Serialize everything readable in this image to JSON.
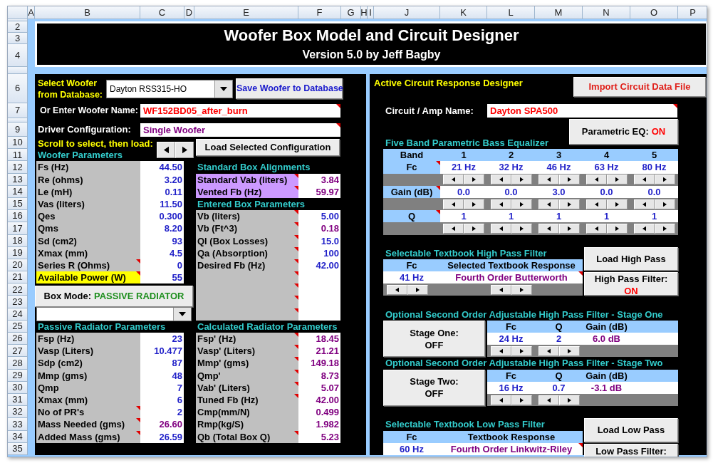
{
  "column_headers": [
    "A",
    "B",
    "C",
    "D",
    "E",
    "F",
    "G",
    "H",
    "I",
    "J",
    "K",
    "L",
    "M",
    "N",
    "O",
    "P"
  ],
  "row_headers": [
    "2",
    "3",
    "4",
    "6",
    "7",
    "9",
    "10",
    "11",
    "12",
    "13",
    "14",
    "15",
    "16",
    "17",
    "18",
    "19",
    "20",
    "21",
    "22",
    "23",
    "24",
    "25",
    "26",
    "27",
    "28",
    "29",
    "30",
    "31",
    "32",
    "33",
    "34",
    "35"
  ],
  "title": "Woofer Box Model and Circuit Designer",
  "subtitle": "Version 5.0 by Jeff Bagby",
  "woofer_select": {
    "label": "Select Woofer from Database:",
    "value": "Dayton RSS315-HO"
  },
  "save_button": "Save Woofer to Database",
  "woofer_name": {
    "label": "Or Enter Woofer Name:",
    "value": "WF152BD05_after_burn",
    "comment": true
  },
  "driver_configuration": {
    "label": "Driver Configuration:",
    "value": "Single Woofer",
    "comment": true
  },
  "scroll_label": "Scroll to select, then load:",
  "load_configuration_button": "Load Selected Configuration",
  "woofer_parameters": {
    "title": "Woofer Parameters",
    "rows": [
      {
        "label": "Fs (Hz)",
        "value": "44.50",
        "kind": "input",
        "comment": false,
        "highlight": false
      },
      {
        "label": "Re (ohms)",
        "value": "3.20",
        "kind": "input",
        "comment": false,
        "highlight": false
      },
      {
        "label": "Le (mH)",
        "value": "0.11",
        "kind": "input",
        "comment": false,
        "highlight": false
      },
      {
        "label": "Vas (liters)",
        "value": "11.50",
        "kind": "input",
        "comment": false,
        "highlight": false
      },
      {
        "label": "Qes",
        "value": "0.300",
        "kind": "input",
        "comment": false,
        "highlight": false
      },
      {
        "label": "Qms",
        "value": "8.20",
        "kind": "input",
        "comment": false,
        "highlight": false
      },
      {
        "label": "Sd (cm2)",
        "value": "93",
        "kind": "input",
        "comment": false,
        "highlight": false
      },
      {
        "label": "Xmax (mm)",
        "value": "4.5",
        "kind": "input",
        "comment": false,
        "highlight": false
      },
      {
        "label": "Series R (Ohms)",
        "value": "0",
        "kind": "input",
        "comment": true,
        "highlight": false
      },
      {
        "label": "Available Power (W)",
        "value": "55",
        "kind": "input",
        "comment": true,
        "highlight": true
      }
    ]
  },
  "standard_box_alignments": {
    "title": "Standard Box Alignments",
    "rows": [
      {
        "label": "Standard Vab (liters)",
        "value": "3.84",
        "kind": "calculated",
        "comment": true
      },
      {
        "label": "Vented Fb (Hz)",
        "value": "59.97",
        "kind": "calculated",
        "comment": true
      }
    ]
  },
  "entered_box_parameters": {
    "title": "Entered Box Parameters",
    "rows": [
      {
        "label": "Vb (liters)",
        "value": "5.00",
        "kind": "input",
        "comment": true
      },
      {
        "label": "Vb (Ft^3)",
        "value": "0.18",
        "kind": "calculated",
        "comment": true
      },
      {
        "label": "Ql (Box Losses)",
        "value": "15.0",
        "kind": "input",
        "comment": true
      },
      {
        "label": "Qa (Absorption)",
        "value": "100",
        "kind": "input",
        "comment": true
      },
      {
        "label": "Desired Fb (Hz)",
        "value": "42.00",
        "kind": "input",
        "comment": true
      },
      {
        "comment": true
      },
      {
        "comment": true
      },
      {
        "comment": true
      },
      {
        "comment": true
      }
    ]
  },
  "box_mode": {
    "label": "Box Mode:",
    "value": "PASSIVE RADIATOR"
  },
  "passive_radiator_parameters": {
    "title": "Passive Radiator Parameters",
    "rows": [
      {
        "label": "Fsp (Hz)",
        "value": "23",
        "kind": "input",
        "comment": false
      },
      {
        "label": "Vasp (Liters)",
        "value": "10.477",
        "kind": "input",
        "comment": false
      },
      {
        "label": "Sdp (cm2)",
        "value": "87",
        "kind": "input",
        "comment": false
      },
      {
        "label": "Mmp (gms)",
        "value": "48",
        "kind": "input",
        "comment": false
      },
      {
        "label": "Qmp",
        "value": "7",
        "kind": "input",
        "comment": false
      },
      {
        "label": "Xmax (mm)",
        "value": "6",
        "kind": "input",
        "comment": false
      },
      {
        "label": "No of PR's",
        "value": "2",
        "kind": "input",
        "comment": true
      },
      {
        "label": "Mass Needed (gms)",
        "value": "26.60",
        "kind": "calculated",
        "comment": true
      },
      {
        "label": "Added Mass (gms)",
        "value": "26.59",
        "kind": "input",
        "comment": true
      }
    ]
  },
  "calculated_radiator_parameters": {
    "title": "Calculated Radiator Parameters",
    "rows": [
      {
        "label": "Fsp' (Hz)",
        "value": "18.45",
        "kind": "calculated",
        "comment": true
      },
      {
        "label": "Vasp' (Liters)",
        "value": "21.21",
        "kind": "calculated",
        "comment": true
      },
      {
        "label": "Mmp' (gms)",
        "value": "149.18",
        "kind": "calculated",
        "comment": true
      },
      {
        "label": "Qmp'",
        "value": "8.73",
        "kind": "calculated",
        "comment": true
      },
      {
        "label": "Vab' (Liters)",
        "value": "5.07",
        "kind": "calculated",
        "comment": true
      },
      {
        "label": "Tuned Fb (Hz)",
        "value": "42.00",
        "kind": "calculated",
        "comment": true
      },
      {
        "label": "Cmp(mm/N)",
        "value": "0.499",
        "kind": "calculated",
        "comment": false
      },
      {
        "label": "Rmp(kg/S)",
        "value": "1.982",
        "kind": "calculated",
        "comment": false
      },
      {
        "label": "Qb (Total Box Q)",
        "value": "5.23",
        "kind": "calculated",
        "comment": true
      }
    ]
  },
  "circuit_designer": {
    "title": "Active Circuit Response Designer",
    "import_button": "Import Circuit Data File",
    "name_label": "Circuit / Amp Name:",
    "name_value": "Dayton SPA500",
    "name_comment": true
  },
  "parametric_eq": {
    "toggle": {
      "label": "Parametric EQ:",
      "state": "ON",
      "on": true
    },
    "title": "Five Band Parametric Bass Equalizer",
    "header": "Band",
    "bands": [
      "1",
      "2",
      "3",
      "4",
      "5"
    ],
    "rows": [
      {
        "label": "Fc",
        "comment": true,
        "values": [
          "21 Hz",
          "32 Hz",
          "46 Hz",
          "63 Hz",
          "80 Hz"
        ]
      },
      {
        "label": "Gain (dB)",
        "comment": true,
        "values": [
          "0.0",
          "0.0",
          "3.0",
          "0.0",
          "0.0"
        ]
      },
      {
        "label": "Q",
        "comment": true,
        "values": [
          "1",
          "1",
          "1",
          "1",
          "1"
        ]
      }
    ]
  },
  "high_pass": {
    "title": "Selectable Textbook High Pass Filter",
    "columns": [
      "Fc",
      "Selected Textbook Response"
    ],
    "values": [
      {
        "text": "41 Hz",
        "kind": "input"
      },
      {
        "text": "Fourth Order Butterworth",
        "kind": "calculated"
      }
    ],
    "comment": true,
    "load_button": "Load High Pass",
    "toggle": {
      "label": "High Pass Filter:",
      "state": "ON",
      "on": true
    }
  },
  "stage_one": {
    "title": "Optional Second Order Adjustable High Pass Filter - Stage One",
    "toggle": {
      "label": "Stage One:",
      "state": "OFF",
      "on": false
    },
    "columns": [
      "Fc",
      "Q",
      "Gain (dB)"
    ],
    "values": [
      {
        "text": "24 Hz",
        "kind": "input"
      },
      {
        "text": "2",
        "kind": "input"
      },
      {
        "text": "6.0 dB",
        "kind": "calculated"
      }
    ]
  },
  "stage_two": {
    "title": "Optional Second Order Adjustable High Pass Filter - Stage Two",
    "toggle": {
      "label": "Stage Two:",
      "state": "OFF",
      "on": false
    },
    "columns": [
      "Fc",
      "Q",
      "Gain (dB)"
    ],
    "values": [
      {
        "text": "16 Hz",
        "kind": "input"
      },
      {
        "text": "0.7",
        "kind": "input"
      },
      {
        "text": "-3.1 dB",
        "kind": "calculated"
      }
    ]
  },
  "low_pass": {
    "title": "Selectable Textbook Low Pass Filter",
    "columns": [
      "Fc",
      "Textbook Response"
    ],
    "values": [
      {
        "text": "60 Hz",
        "kind": "input"
      },
      {
        "text": "Fourth Order Linkwitz-Riley",
        "kind": "calculated"
      }
    ],
    "comment": true,
    "load_button": "Load Low Pass",
    "toggle": {
      "label": "Low Pass Filter:"
    }
  }
}
